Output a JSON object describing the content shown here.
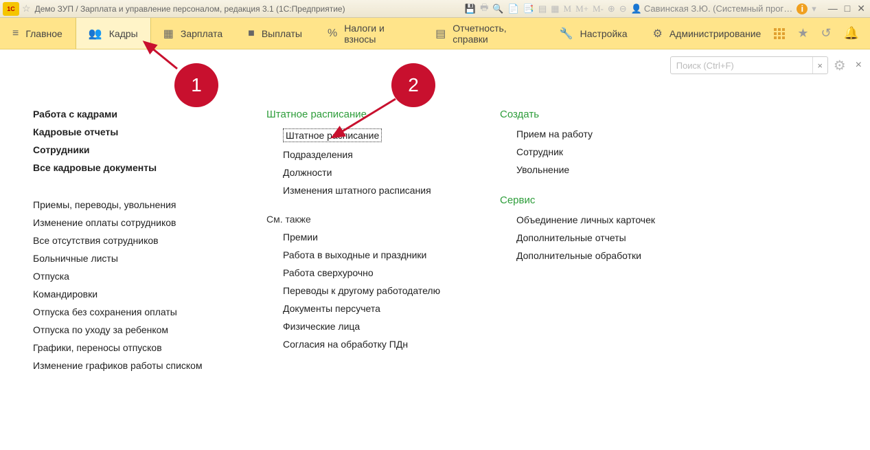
{
  "titlebar": {
    "title": "Демо ЗУП / Зарплата и управление персоналом, редакция 3.1  (1С:Предприятие)",
    "user": "Савинская З.Ю. (Системный прог…"
  },
  "menu": {
    "items": [
      {
        "label": "Главное"
      },
      {
        "label": "Кадры"
      },
      {
        "label": "Зарплата"
      },
      {
        "label": "Выплаты"
      },
      {
        "label": "Налоги и взносы"
      },
      {
        "label": "Отчетность, справки"
      },
      {
        "label": "Настройка"
      },
      {
        "label": "Администрирование"
      }
    ]
  },
  "search": {
    "placeholder": "Поиск (Ctrl+F)"
  },
  "col1": {
    "bold": [
      "Работа с кадрами",
      "Кадровые отчеты",
      "Сотрудники",
      "Все кадровые документы"
    ],
    "links": [
      "Приемы, переводы, увольнения",
      "Изменение оплаты сотрудников",
      "Все отсутствия сотрудников",
      "Больничные листы",
      "Отпуска",
      "Командировки",
      "Отпуска без сохранения оплаты",
      "Отпуска по уходу за ребенком",
      "Графики, переносы отпусков",
      "Изменение графиков работы списком"
    ]
  },
  "col2": {
    "head": "Штатное расписание",
    "links": [
      "Штатное расписание",
      "Подразделения",
      "Должности",
      "Изменения штатного расписания"
    ],
    "subhead": "См. также",
    "sublinks": [
      "Премии",
      "Работа в выходные и праздники",
      "Работа сверхурочно",
      "Переводы к другому работодателю",
      "Документы персучета",
      "Физические лица",
      "Согласия на обработку ПДн"
    ]
  },
  "col3": {
    "head1": "Создать",
    "links1": [
      "Прием на работу",
      "Сотрудник",
      "Увольнение"
    ],
    "head2": "Сервис",
    "links2": [
      "Объединение личных карточек",
      "Дополнительные отчеты",
      "Дополнительные обработки"
    ]
  },
  "callouts": {
    "one": "1",
    "two": "2"
  }
}
